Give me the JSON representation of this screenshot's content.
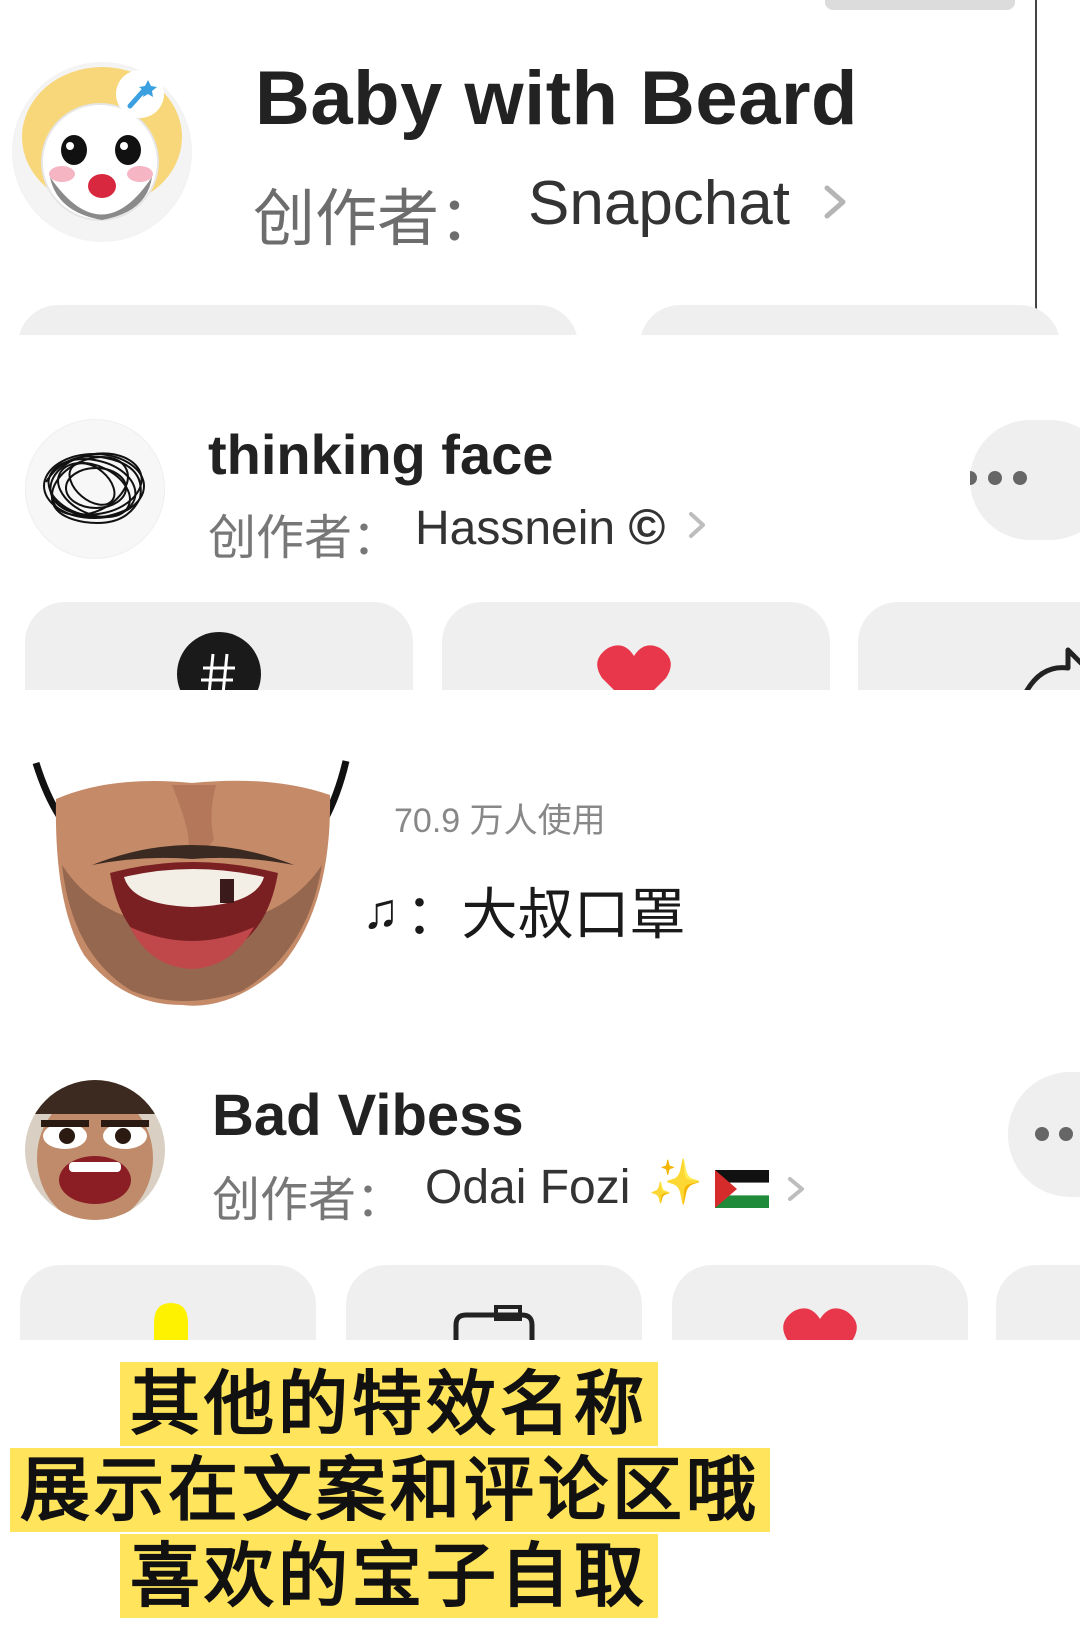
{
  "panel1": {
    "lens_title": "Baby with Beard",
    "creator_label": "创作者：",
    "creator_name": "Snapchat"
  },
  "panel2": {
    "lens_title": "thinking face",
    "creator_label": "创作者：",
    "creator_name": "Hassnein",
    "copyright_mark": "©"
  },
  "panel3": {
    "users_count": "70.9 万人使用",
    "music_icon": "♫",
    "music_label": "：大叔口罩"
  },
  "panel4": {
    "lens_title": "Bad Vibess",
    "creator_label": "创作者：",
    "creator_name": "Odai Fozi",
    "sparkle_emoji": "✨",
    "flag": "palestine-flag"
  },
  "caption": {
    "line1": "其他的特效名称",
    "line2": "展示在文案和评论区哦",
    "line3": "喜欢的宝子自取"
  },
  "colors": {
    "caption_highlight": "#ffe45c",
    "heart_red": "#e8374a",
    "pill_gray": "#efefef"
  }
}
